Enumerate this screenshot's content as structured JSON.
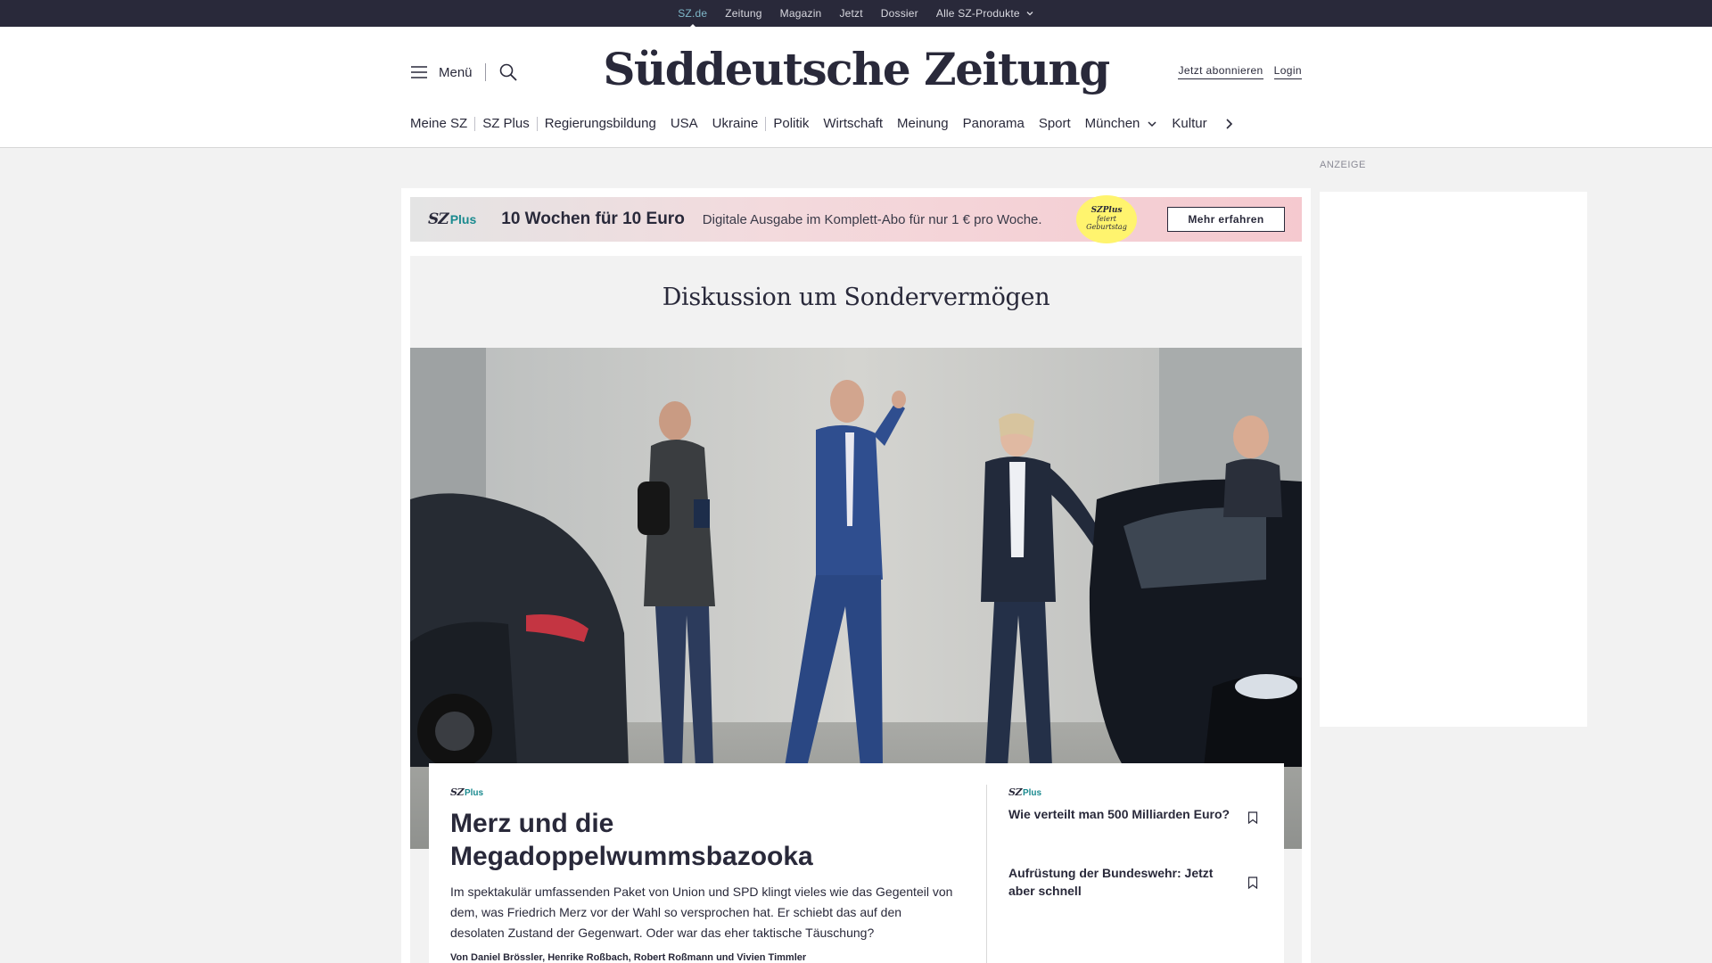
{
  "topbar": {
    "items": [
      "SZ.de",
      "Zeitung",
      "Magazin",
      "Jetzt",
      "Dossier",
      "Alle SZ-Produkte"
    ]
  },
  "header": {
    "menu_label": "Menü",
    "logo": "Süddeutsche Zeitung",
    "subscribe": "Jetzt abonnieren",
    "login": "Login"
  },
  "nav": {
    "items": [
      "Meine SZ",
      "SZ Plus",
      "Regierungsbildung",
      "USA",
      "Ukraine",
      "Politik",
      "Wirtschaft",
      "Meinung",
      "Panorama",
      "Sport",
      "München",
      "Kultur"
    ]
  },
  "ad": {
    "label": "ANZEIGE"
  },
  "promo": {
    "logo": "SZ",
    "logo_plus": "Plus",
    "headline": "10 Wochen für 10 Euro",
    "text": "Digitale Ausgabe im Komplett-Abo für nur 1 € pro Woche.",
    "badge_line1": "SZPlus",
    "badge_line2": "feiert",
    "badge_line3": "Geburtstag",
    "button": "Mehr erfahren"
  },
  "hero": {
    "kicker": "Diskussion um Sondervermögen",
    "image": "photo-politician-leaving-car"
  },
  "lead_article": {
    "badge": "SZ",
    "badge_plus": "Plus",
    "title": "Merz und die Megadoppelwummsbazooka",
    "teaser": "Im spektakulär umfassenden Paket von Union und SPD klingt vieles wie das Gegenteil von dem, was Friedrich Merz vor der Wahl so versprochen hat. Er schiebt das auf den desolaten Zustand der Gegenwart. Oder war das eher taktische Täuschung?",
    "authors": "Von Daniel Brössler, Henrike Roßbach, Robert Roßmann und Vivien Timmler"
  },
  "side_articles": [
    {
      "badge": "SZ",
      "badge_plus": "Plus",
      "title": "Wie verteilt man 500 Milliarden Euro?"
    },
    {
      "title": "Aufrüstung der Bundeswehr: Jetzt aber schnell"
    }
  ],
  "colors": {
    "topbar": "#29293a",
    "accent_plus": "#1a8a8f",
    "badge_yellow": "#fff46e"
  }
}
